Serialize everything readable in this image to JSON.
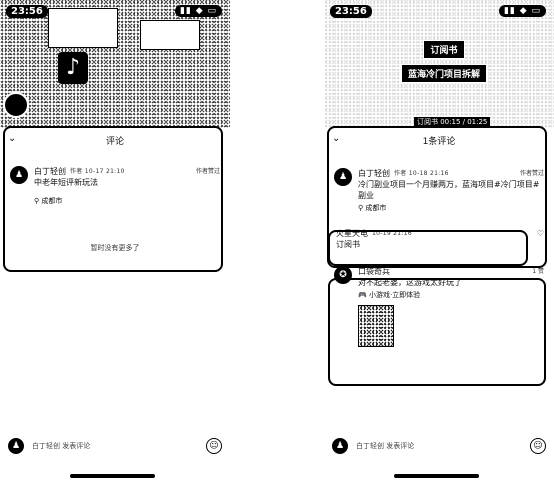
{
  "left": {
    "status_time": "23:56",
    "comments_title": "评论",
    "comment": {
      "user": "白丁轻创",
      "meta": "作者 10-17 21:10",
      "like": "作者赞过",
      "text": "中老年短评新玩法",
      "location": "成都市"
    },
    "reply_link": "暂时没有更多了",
    "input_placeholder": "白丁轻创 发表评论"
  },
  "right": {
    "status_time": "23:56",
    "status_icons": "▮▮ ◆ ▭",
    "banner_line1": "订阅书",
    "banner_line2": "蓝海冷门项目拆解",
    "video_caption": "订阅书 00:15 / 01:25",
    "comments_title": "1条评论",
    "author_comment": {
      "user": "白丁轻创",
      "meta": "作者 10-18 21:16",
      "like": "作者赞过",
      "text": "冷门副业项目一个月赚两万，蓝海项目#冷门项目#副业",
      "location": "成都市"
    },
    "reply1": {
      "user": "火星天电",
      "meta": "10-19 21:16",
      "text": "订阅书"
    },
    "reply2": {
      "user": "口袋奇兵",
      "meta": "1 赞",
      "text": "对不起老婆，这游戏太好玩了",
      "game_link": "小游戏·立即体验"
    },
    "input_placeholder": "白丁轻创 发表评论"
  }
}
